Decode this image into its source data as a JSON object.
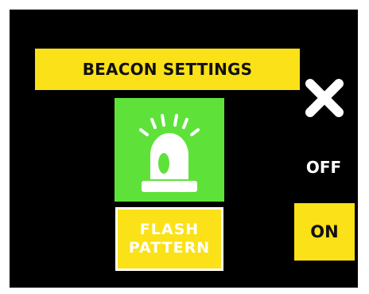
{
  "header": {
    "title": "BEACON SETTINGS"
  },
  "close": {
    "icon": "close-icon"
  },
  "beacon": {
    "icon": "beacon-light-icon"
  },
  "flash_pattern": {
    "label": "FLASH\nPATTERN"
  },
  "toggle": {
    "off_label": "OFF",
    "on_label": "ON",
    "selected": "ON"
  },
  "colors": {
    "background": "#000000",
    "accent": "#fbe117",
    "beacon_active": "#5ee23a",
    "text_light": "#ffffff",
    "text_dark": "#111111"
  }
}
